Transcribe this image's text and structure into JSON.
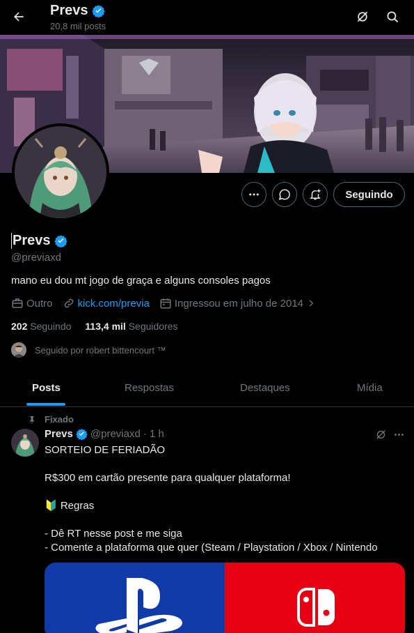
{
  "header": {
    "name": "Prevs",
    "subtitle": "20,8 mil posts",
    "back_icon": "arrow-left-icon",
    "grok_icon": "grok-icon",
    "search_icon": "search-icon"
  },
  "profile": {
    "name": "Prevs",
    "handle": "@previaxd",
    "bio": "mano eu dou mt jogo de graça e alguns consoles pagos",
    "category": "Outro",
    "link": "kick.com/previa",
    "joined": "Ingressou em julho de 2014",
    "following_count": "202",
    "following_label": "Seguindo",
    "followers_count": "113,4 mil",
    "followers_label": "Seguidores",
    "followed_by": "Seguido por robert bittencourt ™",
    "follow_button": "Seguindo"
  },
  "tabs": [
    {
      "label": "Posts",
      "active": true
    },
    {
      "label": "Respostas",
      "active": false
    },
    {
      "label": "Destaques",
      "active": false
    },
    {
      "label": "Mídia",
      "active": false
    }
  ],
  "post": {
    "pinned_label": "Fixado",
    "author": "Prevs",
    "handle": "@previaxd",
    "time": "· 1 h",
    "lines": [
      "SORTEIO DE FERIADÃO",
      "R$300 em cartão presente para qualquer plataforma!",
      "🔰 Regras",
      "- Dê RT nesse post e me siga",
      "- Comente a plataforma que quer (Steam / Playstation / Xbox / Nintendo"
    ]
  },
  "colors": {
    "accent": "#1d9bf0",
    "background": "#000000",
    "muted": "#71767b",
    "playstation": "#0f3aa8",
    "nintendo": "#e60012"
  }
}
